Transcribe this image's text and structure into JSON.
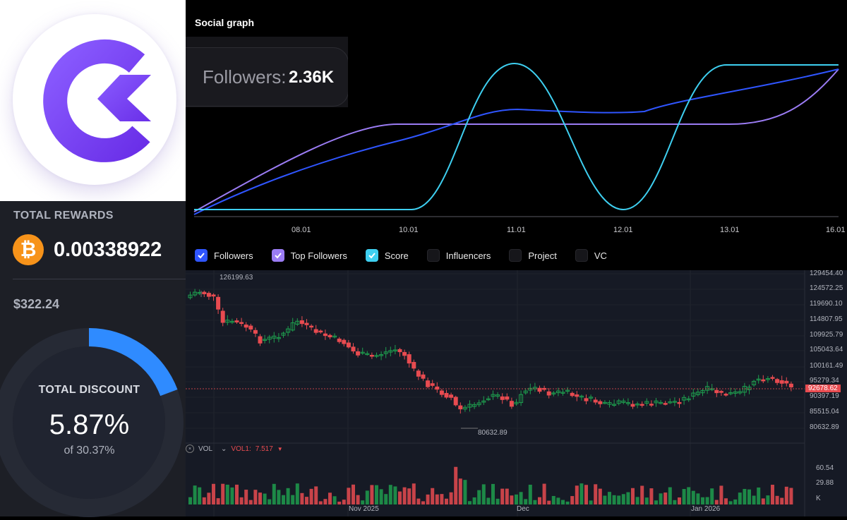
{
  "rewards": {
    "total_rewards_label": "TOTAL REWARDS",
    "btc_symbol": "₿",
    "btc_amount": "0.00338922",
    "usd_value": "$322.24",
    "discount_label": "TOTAL DISCOUNT",
    "discount_value": "5.87%",
    "discount_of": "of 30.37%",
    "discount_fraction": 0.193,
    "ring_color": "#2f8bff"
  },
  "social_graph": {
    "title": "Social graph",
    "followers_label": "Followers:",
    "followers_value": "2.36K",
    "x_ticks": [
      "08.01",
      "10.01",
      "11.01",
      "12.01",
      "13.01",
      "16.01"
    ],
    "legend": [
      {
        "label": "Followers",
        "checked": true,
        "color": "#2f55ff"
      },
      {
        "label": "Top Followers",
        "checked": true,
        "color": "#9b7cf4"
      },
      {
        "label": "Score",
        "checked": true,
        "color": "#3ecff0"
      },
      {
        "label": "Influencers",
        "checked": false,
        "color": "#16161a"
      },
      {
        "label": "Project",
        "checked": false,
        "color": "#16161a"
      },
      {
        "label": "VC",
        "checked": false,
        "color": "#16161a"
      }
    ]
  },
  "price_chart": {
    "y_axis": [
      "129454.40",
      "124572.25",
      "119690.10",
      "114807.95",
      "109925.79",
      "105043.64",
      "100161.49",
      "95279.34",
      "90397.19",
      "85515.04",
      "80632.89"
    ],
    "current_price": "92678.62",
    "high_label": "126199.63",
    "low_label": "80632.89",
    "x_axis": [
      "Nov 2025",
      "Dec",
      "Jan 2026"
    ],
    "vol_label": "VOL",
    "vol1_label": "VOL1:",
    "vol1_value": "7.517",
    "vol_axis": [
      "60.54",
      "29.88",
      "K"
    ],
    "up_color": "#1e9e4e",
    "down_color": "#e84b50"
  }
}
